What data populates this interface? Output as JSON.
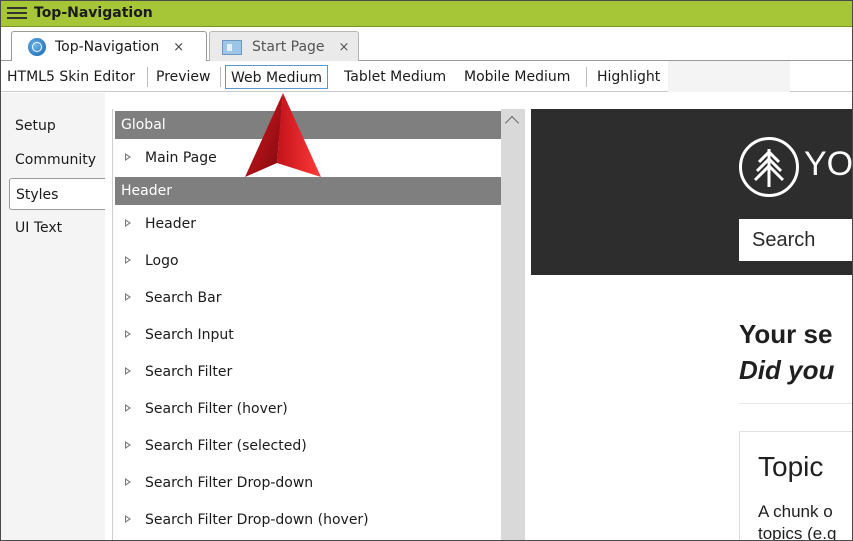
{
  "window": {
    "title": "Top-Navigation"
  },
  "tabs": [
    {
      "label": "Top-Navigation",
      "close": "×",
      "icon": "globe-icon",
      "active": true
    },
    {
      "label": "Start Page",
      "close": "×",
      "icon": "page-icon",
      "active": false
    }
  ],
  "toolbar": {
    "items": [
      "HTML5 Skin Editor",
      "Preview",
      "Web Medium",
      "Tablet Medium",
      "Mobile Medium",
      "Highlight"
    ],
    "selected": "Web Medium",
    "selected_border_color": "#5b97d6"
  },
  "sidetabs": [
    "Setup",
    "Community",
    "Styles",
    "UI Text"
  ],
  "sidetab_active": "Styles",
  "style_list": {
    "groups": [
      {
        "header": "Global",
        "items": [
          "Main Page"
        ]
      },
      {
        "header": "Header",
        "items": [
          "Header",
          "Logo",
          "Search Bar",
          "Search Input",
          "Search Filter",
          "Search Filter (hover)",
          "Search Filter (selected)",
          "Search Filter Drop-down",
          "Search Filter Drop-down (hover)"
        ]
      }
    ]
  },
  "preview": {
    "logo_text": "YO",
    "search_placeholder": "Search",
    "heading": "Your se",
    "subheading": "Did you",
    "topic_title": "Topic",
    "topic_body_line1": "A chunk o",
    "topic_body_line2": " topics (e.g"
  },
  "colors": {
    "titlebar": "#a6c638",
    "group_header": "#7f7f7f",
    "preview_header": "#2d2d2d",
    "arrow": "#b01018"
  }
}
